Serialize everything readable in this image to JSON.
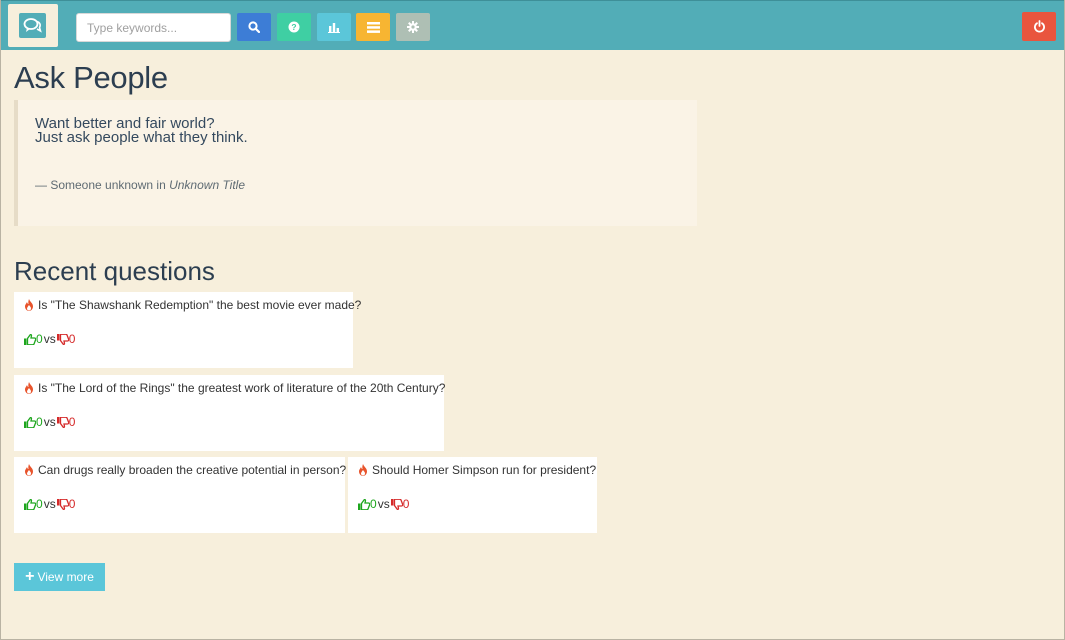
{
  "header": {
    "search_placeholder": "Type keywords..."
  },
  "icons": {
    "brand": "chat-bubbles-icon",
    "search": "search-icon",
    "help": "question-icon",
    "stats": "bar-chart-icon",
    "list": "list-icon",
    "settings": "gear-icon",
    "logout": "power-icon",
    "hot": "fire-icon",
    "like": "thumbs-up-icon",
    "dislike": "thumbs-down-icon"
  },
  "colors": {
    "navbar": "#52adb7",
    "background": "#f7efdc",
    "search_button": "#3d7dd6",
    "help_button": "#3fcfa3",
    "stats_button": "#5bc6d9",
    "list_button": "#f7b532",
    "settings_button": "#aebfb4",
    "power_button": "#e9553e",
    "up_votes": "#1ea61e",
    "down_votes": "#d52a2a"
  },
  "main": {
    "title": "Ask People",
    "quote": {
      "line1": "Want better and fair world?",
      "line2": "Just ask people what they think.",
      "author_prefix": "— Someone unknown in",
      "source": "Unknown Title"
    },
    "recent_title": "Recent questions",
    "questions": [
      {
        "text": "Is \"The Shawshank Redemption\" the best movie ever made?",
        "up": "0",
        "vs": "vs",
        "down": "0"
      },
      {
        "text": "Is \"The Lord of the Rings\" the greatest work of literature of the 20th Century?",
        "up": "0",
        "vs": "vs",
        "down": "0"
      },
      {
        "text": "Can drugs really broaden the creative potential in person?",
        "up": "0",
        "vs": "vs",
        "down": "0"
      },
      {
        "text": "Should Homer Simpson run for president?",
        "up": "0",
        "vs": "vs",
        "down": "0"
      }
    ],
    "view_more_label": "View more"
  }
}
